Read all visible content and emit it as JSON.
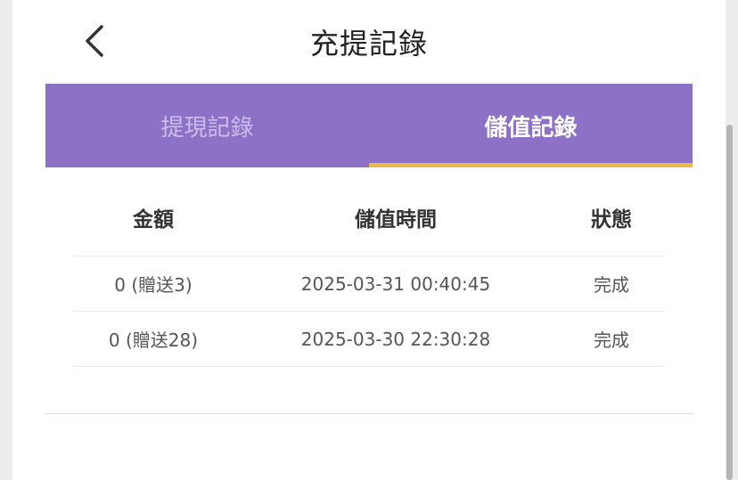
{
  "header": {
    "title": "充提記錄",
    "back_icon": "chevron-left-icon"
  },
  "tabs": [
    {
      "label": "提現記錄",
      "active": false
    },
    {
      "label": "儲值記錄",
      "active": true
    }
  ],
  "table": {
    "columns": [
      "金額",
      "儲值時間",
      "狀態"
    ],
    "rows": [
      {
        "amount": "0 (贈送3)",
        "time": "2025-03-31 00:40:45",
        "status": "完成"
      },
      {
        "amount": "0 (贈送28)",
        "time": "2025-03-30 22:30:28",
        "status": "完成"
      }
    ]
  },
  "colors": {
    "tab_bar": "#8c71c6",
    "tab_indicator": "#e9bb45",
    "tab_inactive_text": "#cbbdeb"
  }
}
